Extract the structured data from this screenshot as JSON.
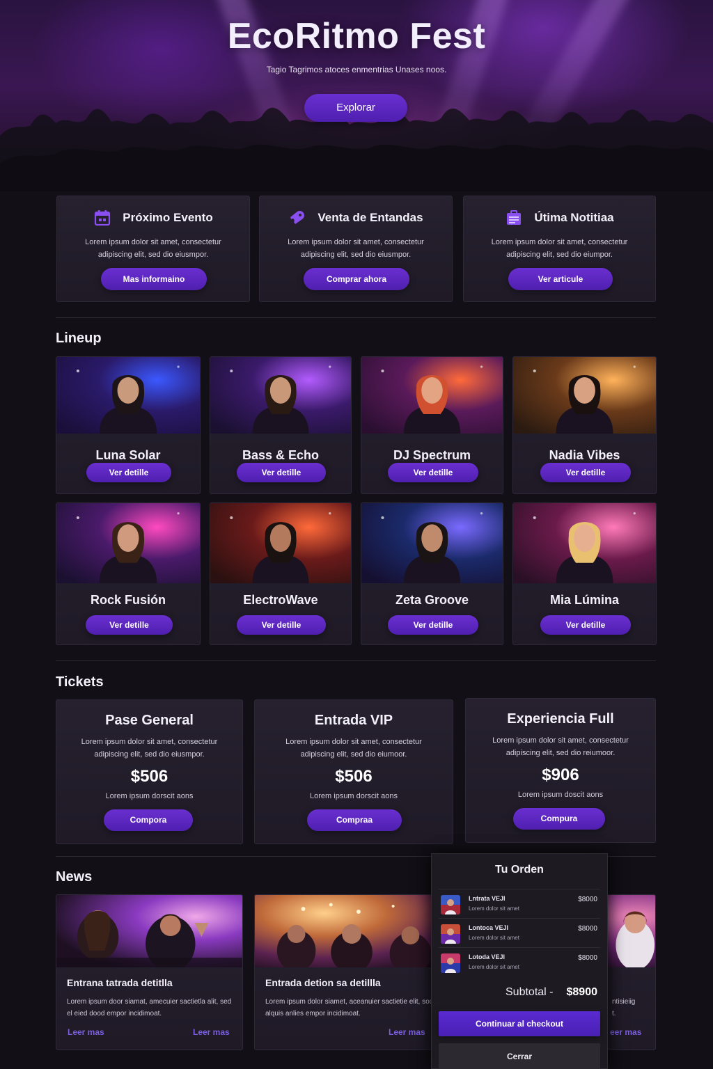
{
  "hero": {
    "title": "EcoRitmo Fest",
    "subtitle": "Tagio Tagrimos atoces enmentrias Unases noos.",
    "cta_label": "Explorar"
  },
  "info_cards": [
    {
      "icon": "calendar-icon",
      "title": "Próximo Evento",
      "text": "Lorem ipsum dolor sit amet, consectetur adipiscing elit, sed dio eiusmpor.",
      "button": "Mas informaino"
    },
    {
      "icon": "ticket-icon",
      "title": "Venta de Entandas",
      "text": "Lorem ipsum dolor sit amet, consectetur adipiscing elit, sed dio eiusmpor.",
      "button": "Comprar ahora"
    },
    {
      "icon": "news-icon",
      "title": "Útima Notitiaa",
      "text": "Lorem ipsum dolor sit amet, consectetur adipiscing elit, sed dio eiumpor.",
      "button": "Ver articule"
    }
  ],
  "lineup": {
    "title": "Lineup",
    "artists": [
      {
        "name": "Luna Solar",
        "button": "Ver detille"
      },
      {
        "name": "Bass & Echo",
        "button": "Ver detille"
      },
      {
        "name": "DJ Spectrum",
        "button": "Ver detille"
      },
      {
        "name": "Nadia Vibes",
        "button": "Ver detille"
      },
      {
        "name": "Rock Fusión",
        "button": "Ver detille"
      },
      {
        "name": "ElectroWave",
        "button": "Ver detille"
      },
      {
        "name": "Zeta Groove",
        "button": "Ver detille"
      },
      {
        "name": "Mia Lúmina",
        "button": "Ver detille"
      }
    ]
  },
  "tickets": {
    "title": "Tickets",
    "items": [
      {
        "name": "Pase General",
        "text": "Lorem ipsum dolor sit amet, consectetur adipiscing elit, sed dio eiusmpor.",
        "price": "$506",
        "note": "Lorem ipsum dorscit aons",
        "button": "Compora"
      },
      {
        "name": "Entrada VIP",
        "text": "Lorem ipsum dolor sit amet, consectetur adipiscing elit, sed dio eiumoor.",
        "price": "$506",
        "note": "Lorem ipsum dorscit aons",
        "button": "Compraa"
      },
      {
        "name": "Experiencia Full",
        "text": "Lorem ipsum dolor sit amet, consectetur adipiscing elit, sed dio reiumoor.",
        "price": "$906",
        "note": "Lorem ipsum doscit aons",
        "button": "Compura"
      }
    ]
  },
  "news": {
    "title": "News",
    "items": [
      {
        "title": "Entrana tatrada detitlla",
        "text": "Lorem ipsum door siamat, amecuier sactietla alit, sed el eied dood empor incidimoat.",
        "link1": "Leer mas",
        "link2": "Leer mas"
      },
      {
        "title": "Entrada detion sa detillla",
        "text": "Lorem ipsum dolor siamet, aceanuier sactietie elit, sod alquis anlies empor incidimoat.",
        "link1": "Leer mas"
      },
      {
        "text_visible": "ntisieiig",
        "text_visible2": "t.",
        "link1": "eer mas"
      }
    ]
  },
  "order": {
    "title": "Tu Orden",
    "items": [
      {
        "name": "Lntrata VEJI",
        "sub": "Lorem dolor sit amet",
        "price": "$8000"
      },
      {
        "name": "Lontoca VEJI",
        "sub": "Lorem dolor sit amet",
        "price": "$8000"
      },
      {
        "name": "Lotoda VEJI",
        "sub": "Lorem dolor sit amet",
        "price": "$8000"
      }
    ],
    "subtotal_label": "Subtotal -",
    "subtotal_value": "$8900",
    "checkout_label": "Continuar al checkout",
    "close_label": "Cerrar"
  },
  "colors": {
    "background": "#121016",
    "card": "#221d29",
    "accent": "#5a28c6",
    "link": "#7a5fe0"
  }
}
